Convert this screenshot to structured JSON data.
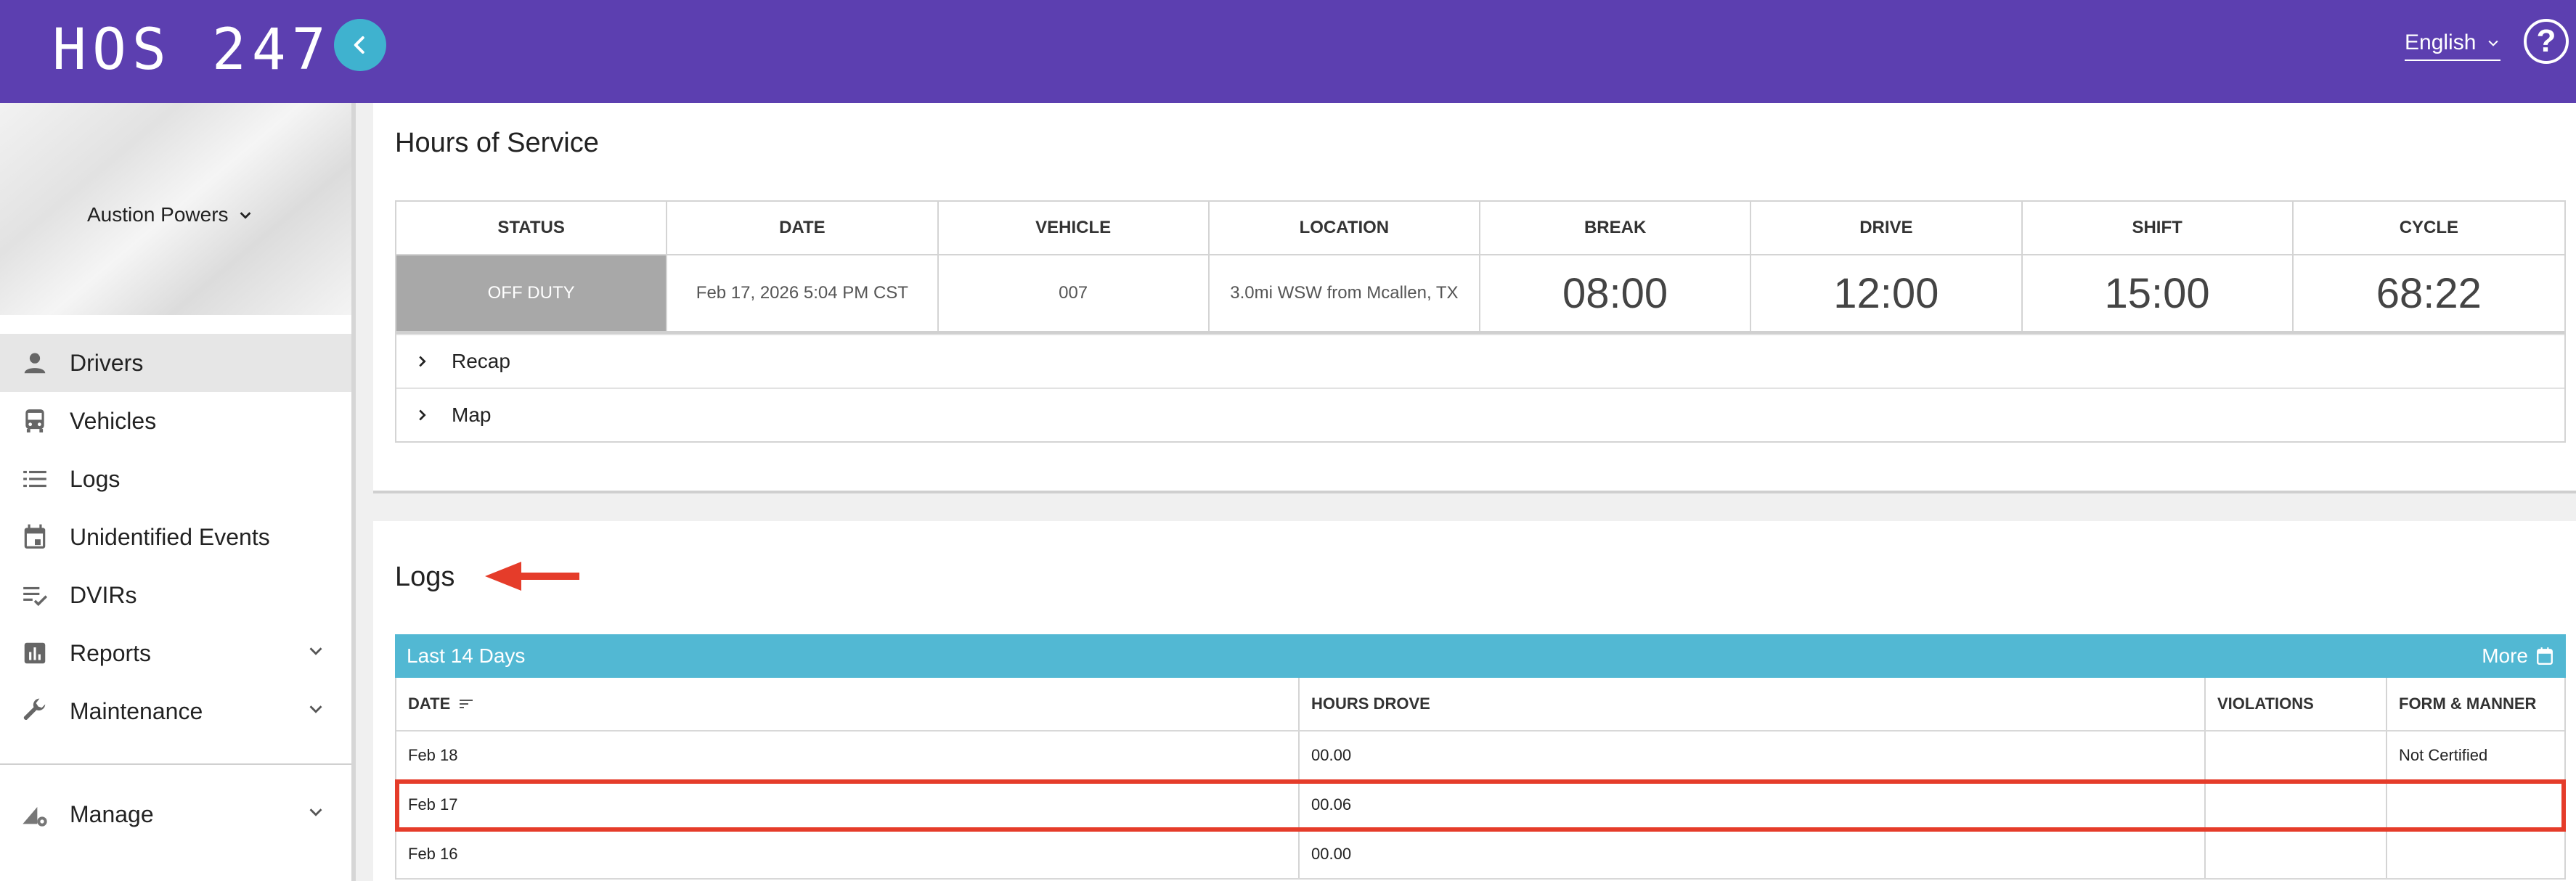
{
  "header": {
    "logo": "HOS 247",
    "language": "English",
    "colors": {
      "header_bg": "#5c3fb0",
      "back_button": "#3fb2cf"
    }
  },
  "sidebar": {
    "profile_name": "Austion Powers",
    "items": [
      {
        "label": "Drivers",
        "icon": "person-icon",
        "active": true
      },
      {
        "label": "Vehicles",
        "icon": "bus-icon"
      },
      {
        "label": "Logs",
        "icon": "list-icon"
      },
      {
        "label": "Unidentified Events",
        "icon": "calendar-icon"
      },
      {
        "label": "DVIRs",
        "icon": "checklist-icon"
      },
      {
        "label": "Reports",
        "icon": "bar-chart-icon",
        "expandable": true
      },
      {
        "label": "Maintenance",
        "icon": "wrench-icon",
        "expandable": true
      }
    ],
    "manage": {
      "label": "Manage",
      "icon": "manage-gear-icon",
      "expandable": true
    }
  },
  "hos": {
    "title": "Hours of Service",
    "headers": [
      "STATUS",
      "DATE",
      "VEHICLE",
      "LOCATION",
      "BREAK",
      "DRIVE",
      "SHIFT",
      "CYCLE"
    ],
    "row": {
      "status": "OFF DUTY",
      "date": "Feb 17, 2026 5:04 PM CST",
      "vehicle": "007",
      "location": "3.0mi WSW from Mcallen, TX",
      "break": "08:00",
      "drive": "12:00",
      "shift": "15:00",
      "cycle": "68:22"
    },
    "recap_label": "Recap",
    "map_label": "Map"
  },
  "logs": {
    "title": "Logs",
    "filter_label": "Last 14 Days",
    "more_label": "More",
    "headers": {
      "date": "DATE",
      "hours_drove": "HOURS DROVE",
      "violations": "VIOLATIONS",
      "form_manner": "FORM & MANNER"
    },
    "rows": [
      {
        "date": "Feb 18",
        "hours_drove": "00.00",
        "violations": "",
        "form_manner": "Not Certified"
      },
      {
        "date": "Feb 17",
        "hours_drove": "00.06",
        "violations": "",
        "form_manner": "",
        "highlighted": true
      },
      {
        "date": "Feb 16",
        "hours_drove": "00.00",
        "violations": "",
        "form_manner": ""
      }
    ],
    "colors": {
      "bar": "#52b8d3",
      "highlight": "#e53c2a"
    }
  }
}
